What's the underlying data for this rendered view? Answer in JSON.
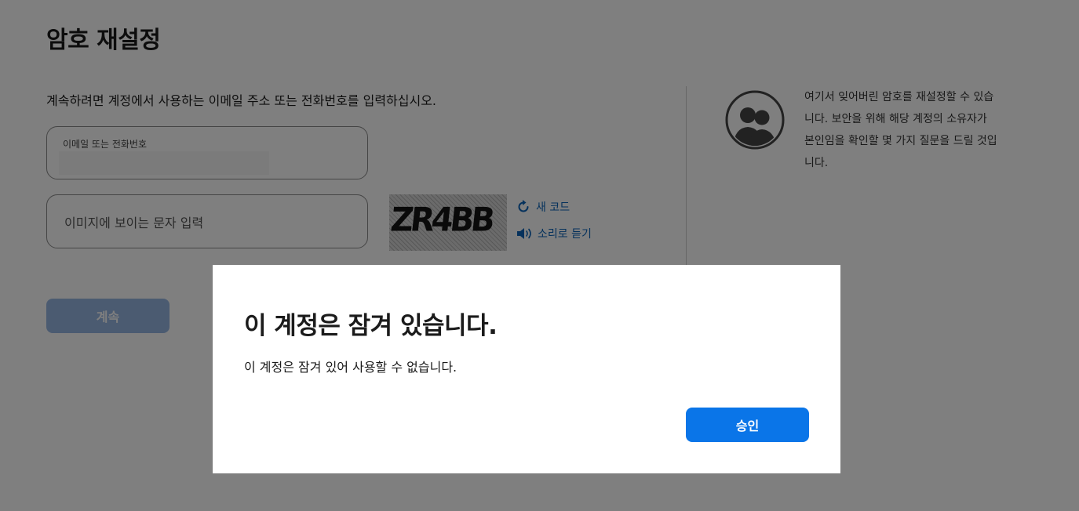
{
  "page": {
    "title": "암호 재설정",
    "instruction": "계속하려면 계정에서 사용하는 이메일 주소 또는 전화번호를 입력하십시오."
  },
  "form": {
    "email_label": "이메일 또는 전화번호",
    "email_value": "",
    "captcha_placeholder": "이미지에 보이는 문자 입력",
    "captcha_value": "",
    "captcha_image_text": "ZR4BB",
    "new_code_label": "새 코드",
    "audio_label": "소리로 듣기",
    "continue_label": "계속"
  },
  "sidebar": {
    "icon": "users-icon",
    "text": "여기서 잊어버린 암호를 재설정할 수 있습니다. 보안을 위해 해당 계정의 소유자가 본인임을 확인할 몇 가지 질문을 드릴 것입니다."
  },
  "modal": {
    "title": "이 계정은 잠겨 있습니다.",
    "message": "이 계정은 잠겨 있어 사용할 수 없습니다.",
    "approve_label": "승인"
  },
  "colors": {
    "link": "#0a63b8",
    "approve_button": "#0a75e8",
    "continue_button_disabled": "#96b6e2",
    "overlay": "#000000"
  }
}
